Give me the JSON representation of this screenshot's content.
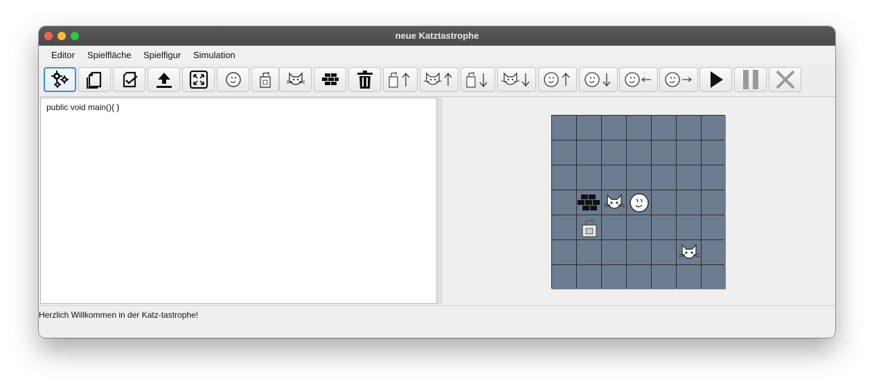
{
  "window": {
    "title": "neue Katztastrophe"
  },
  "menu": {
    "items": [
      "Editor",
      "Spielfläche",
      "Spielfigur",
      "Simulation"
    ]
  },
  "toolbar": {
    "buttons": [
      {
        "name": "compile-button",
        "icon": "gears-icon",
        "selected": true
      },
      {
        "name": "new-file-button",
        "icon": "new-document-icon"
      },
      {
        "name": "open-file-button",
        "icon": "open-document-icon"
      },
      {
        "name": "upload-button",
        "icon": "upload-icon"
      },
      {
        "name": "resize-territory-button",
        "icon": "expand-icon"
      },
      {
        "name": "place-player-button",
        "icon": "player-face-icon"
      },
      {
        "name": "place-food-button",
        "icon": "food-bag-icon"
      },
      {
        "name": "place-cat-button",
        "icon": "cat-icon"
      },
      {
        "name": "place-wall-button",
        "icon": "wall-icon"
      },
      {
        "name": "delete-button",
        "icon": "trash-icon"
      },
      {
        "name": "food-up-button",
        "icon": "food-up-icon"
      },
      {
        "name": "cat-up-button",
        "icon": "cat-up-icon"
      },
      {
        "name": "food-down-button",
        "icon": "food-down-icon"
      },
      {
        "name": "cat-down-button",
        "icon": "cat-down-icon"
      },
      {
        "name": "player-up-button",
        "icon": "player-up-icon"
      },
      {
        "name": "player-down-button",
        "icon": "player-down-icon"
      },
      {
        "name": "player-left-button",
        "icon": "player-left-icon"
      },
      {
        "name": "player-right-button",
        "icon": "player-right-icon"
      },
      {
        "name": "play-button",
        "icon": "play-icon"
      },
      {
        "name": "pause-button",
        "icon": "pause-icon"
      },
      {
        "name": "stop-button",
        "icon": "stop-icon"
      }
    ]
  },
  "editor": {
    "code": "public void main(){  }"
  },
  "territory": {
    "rows": 7,
    "cols": 7,
    "objects": [
      {
        "row": 3,
        "col": 1,
        "type": "wall"
      },
      {
        "row": 3,
        "col": 2,
        "type": "cat"
      },
      {
        "row": 3,
        "col": 3,
        "type": "player"
      },
      {
        "row": 4,
        "col": 1,
        "type": "food"
      },
      {
        "row": 5,
        "col": 5,
        "type": "cat"
      }
    ]
  },
  "status": {
    "message": "Herzlich Willkommen in der Katz-tastrophe!"
  }
}
